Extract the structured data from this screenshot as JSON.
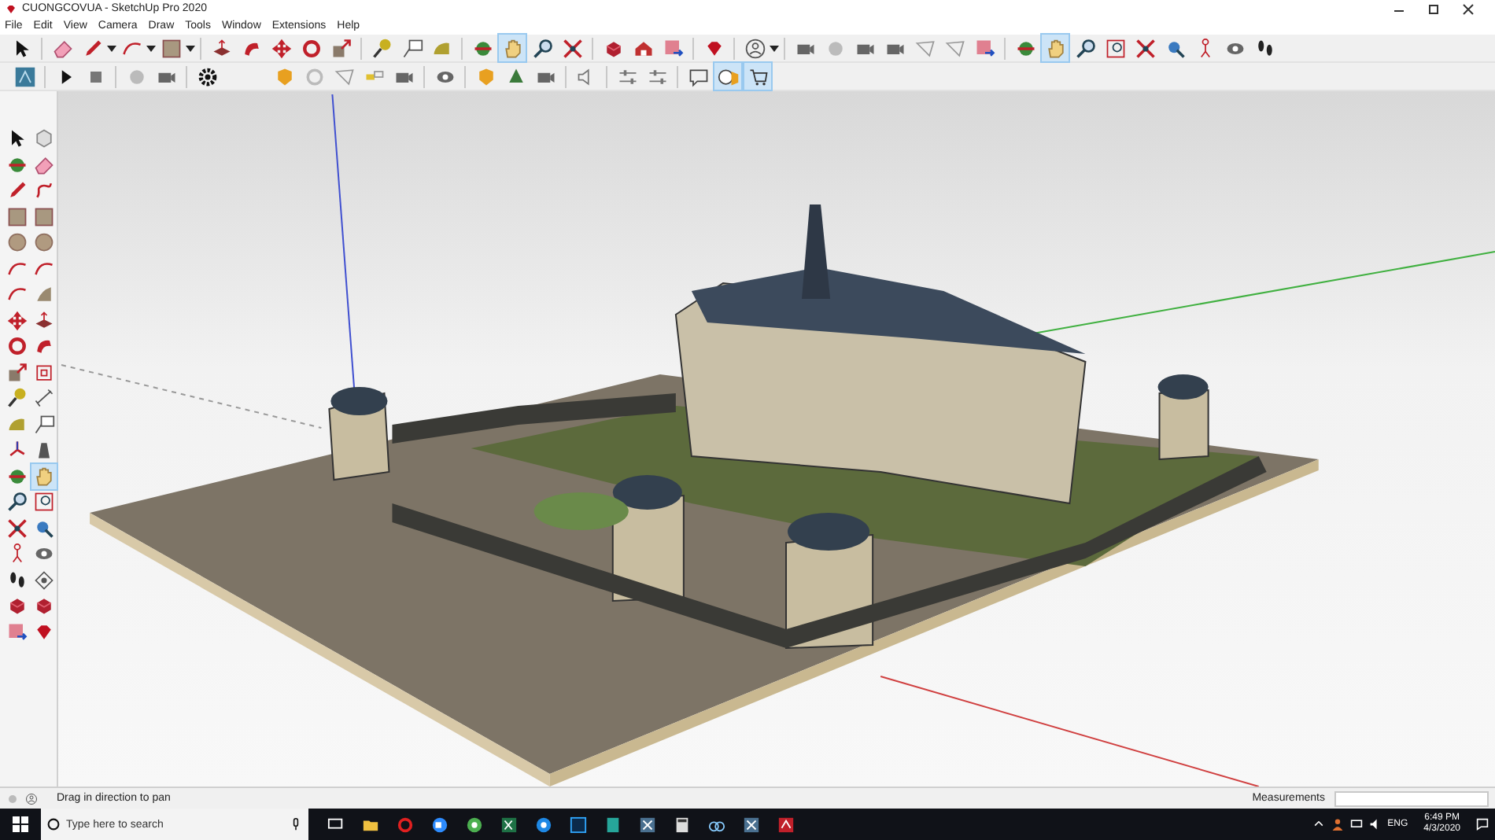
{
  "window": {
    "title": "CUONGCOVUA - SketchUp Pro 2020"
  },
  "menu": [
    "File",
    "Edit",
    "View",
    "Camera",
    "Draw",
    "Tools",
    "Window",
    "Extensions",
    "Help"
  ],
  "toolbar_row_1": [
    {
      "selected": false
    },
    {
      "selected": false
    },
    {
      "selected": false
    },
    {
      "selected": false
    },
    {
      "selected": false
    },
    {
      "selected": false
    },
    {
      "selected": false
    },
    {
      "selected": false
    },
    {
      "selected": false
    },
    {
      "selected": false
    },
    {
      "selected": false
    },
    {
      "selected": false
    },
    {
      "selected": false
    },
    {
      "selected": false
    },
    {
      "selected": true
    },
    {
      "selected": false
    },
    {
      "selected": false
    },
    {
      "selected": false
    },
    {
      "selected": false
    },
    {
      "selected": false
    },
    {
      "selected": false
    },
    {
      "selected": false
    },
    {
      "selected": false
    },
    {
      "selected": false
    },
    {
      "selected": false
    },
    {
      "selected": false
    },
    {
      "selected": false
    },
    {
      "selected": false
    },
    {
      "selected": false
    },
    {
      "selected": false
    },
    {
      "selected": true
    },
    {
      "selected": false
    },
    {
      "selected": false
    },
    {
      "selected": false
    },
    {
      "selected": false
    },
    {
      "selected": false
    },
    {
      "selected": false
    },
    {
      "selected": false
    }
  ],
  "toolbar_row_2": [
    {
      "selected": false
    },
    {
      "selected": false
    },
    {
      "selected": false
    },
    {
      "selected": false
    },
    {
      "selected": false
    },
    {
      "selected": false
    },
    {
      "selected": false
    },
    {
      "selected": false
    },
    {
      "selected": false
    },
    {
      "selected": false
    },
    {
      "selected": false
    },
    {
      "selected": false
    },
    {
      "selected": false
    },
    {
      "selected": false
    },
    {
      "selected": false
    },
    {
      "selected": false
    },
    {
      "selected": false
    },
    {
      "selected": false
    },
    {
      "selected": false
    },
    {
      "selected": true
    },
    {
      "selected": true
    }
  ],
  "left_toolbar": [
    {
      "selected": false
    },
    {
      "selected": false
    },
    {
      "selected": false
    },
    {
      "selected": false
    },
    {
      "selected": false
    },
    {
      "selected": false
    },
    {
      "selected": false
    },
    {
      "selected": false
    },
    {
      "selected": false
    },
    {
      "selected": false
    },
    {
      "selected": false
    },
    {
      "selected": false
    },
    {
      "selected": false
    },
    {
      "selected": false
    },
    {
      "selected": false
    },
    {
      "selected": false
    },
    {
      "selected": false
    },
    {
      "selected": false
    },
    {
      "selected": false
    },
    {
      "selected": false
    },
    {
      "selected": false
    },
    {
      "selected": false
    },
    {
      "selected": false
    },
    {
      "selected": false
    },
    {
      "selected": false
    },
    {
      "selected": false
    },
    {
      "selected": false
    },
    {
      "selected": true
    },
    {
      "selected": false
    },
    {
      "selected": false
    },
    {
      "selected": false
    },
    {
      "selected": false
    },
    {
      "selected": false
    },
    {
      "selected": false
    },
    {
      "selected": false
    },
    {
      "selected": false
    },
    {
      "selected": false
    },
    {
      "selected": false
    },
    {
      "selected": false
    },
    {
      "selected": false
    }
  ],
  "status_bar": {
    "hint": "Drag in direction to pan",
    "measurements_label": "Measurements"
  },
  "taskbar": {
    "search": {
      "placeholder": "Type here to search"
    },
    "language": "ENG",
    "time": "6:49 PM",
    "date": "4/3/2020"
  }
}
